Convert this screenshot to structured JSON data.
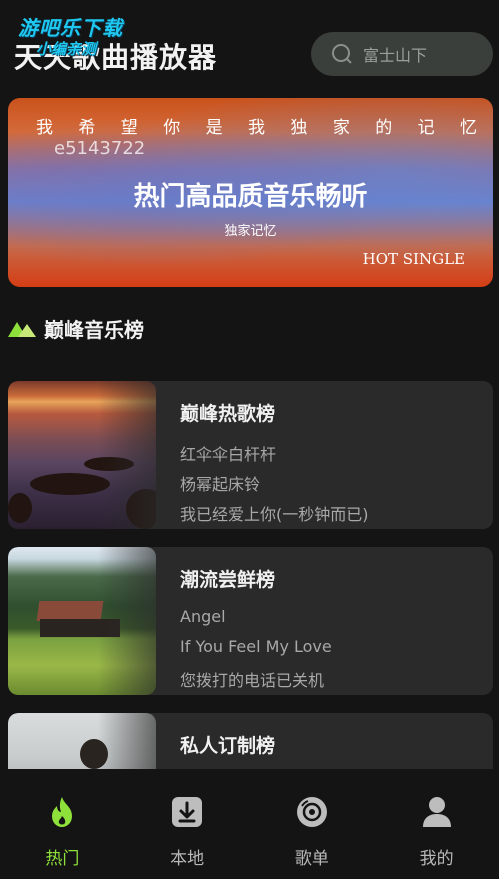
{
  "header": {
    "watermark": "游吧乐下载",
    "watermark_sub": "小编亲测",
    "title": "天天歌曲播放器",
    "search_placeholder": "富士山下"
  },
  "banner": {
    "lyric_line": "我 希 望 你   是 我 独 家 的 记 忆",
    "code": "e5143722",
    "headline": "热门高品质音乐畅听",
    "subtitle": "独家记忆",
    "tag": "HOT SINGLE"
  },
  "section": {
    "icon": "mountain-icon",
    "title": "巅峰音乐榜"
  },
  "charts": [
    {
      "title": "巅峰热歌榜",
      "songs": [
        "红伞伞白杆杆",
        "杨幂起床铃",
        "我已经爱上你(一秒钟而已)"
      ]
    },
    {
      "title": "潮流尝鲜榜",
      "songs": [
        "Angel",
        "If You Feel My Love",
        "您拨打的电话已关机"
      ]
    },
    {
      "title": "私人订制榜",
      "songs": []
    }
  ],
  "nav": {
    "items": [
      {
        "label": "热门",
        "icon": "flame-icon",
        "active": true
      },
      {
        "label": "本地",
        "icon": "download-icon",
        "active": false
      },
      {
        "label": "歌单",
        "icon": "disc-icon",
        "active": false
      },
      {
        "label": "我的",
        "icon": "user-icon",
        "active": false
      }
    ]
  },
  "colors": {
    "accent": "#8ee03a",
    "background": "#141414",
    "card": "#2a2a2a"
  }
}
